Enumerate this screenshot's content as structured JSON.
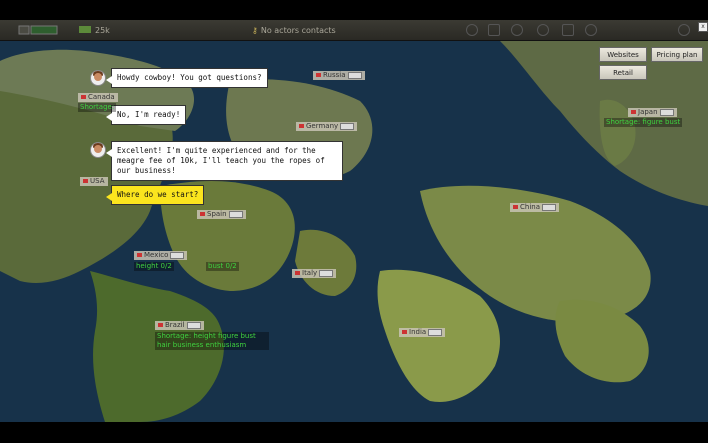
{
  "topbar": {
    "money": "25k",
    "contacts": "No actors contacts"
  },
  "right_buttons": {
    "websites": "Websites",
    "pricing_plan": "Pricing plan",
    "retail": "Retail"
  },
  "dialogue": [
    {
      "speaker": "npc",
      "text": "Howdy cowboy! You got questions?"
    },
    {
      "speaker": "player",
      "text": "No, I'm ready!"
    },
    {
      "speaker": "npc",
      "text": "Excellent! I'm quite experienced and for the meagre fee of 10k, I'll teach you the ropes of our business!"
    },
    {
      "speaker": "player",
      "text": "Where do we start?"
    }
  ],
  "countries": {
    "russia": "Russia",
    "canada": "Canada",
    "germany": "Germany",
    "japan": "Japan",
    "usa": "USA",
    "china": "China",
    "spain": "Spain",
    "mexico": "Mexico",
    "italy": "Italy",
    "brazil": "Brazil",
    "india": "India"
  },
  "shortages": {
    "canada": "Shortage:",
    "japan": "Shortage: figure bust",
    "mexico_a": "height 0/2",
    "mexico_b": "bust 0/2",
    "brazil": "Shortage: height figure bust hair business enthusiasm"
  },
  "colors": {
    "shortage_green": "#3fd23f",
    "bubble_yellow": "#fbe51e",
    "ocean": "#17324a"
  }
}
